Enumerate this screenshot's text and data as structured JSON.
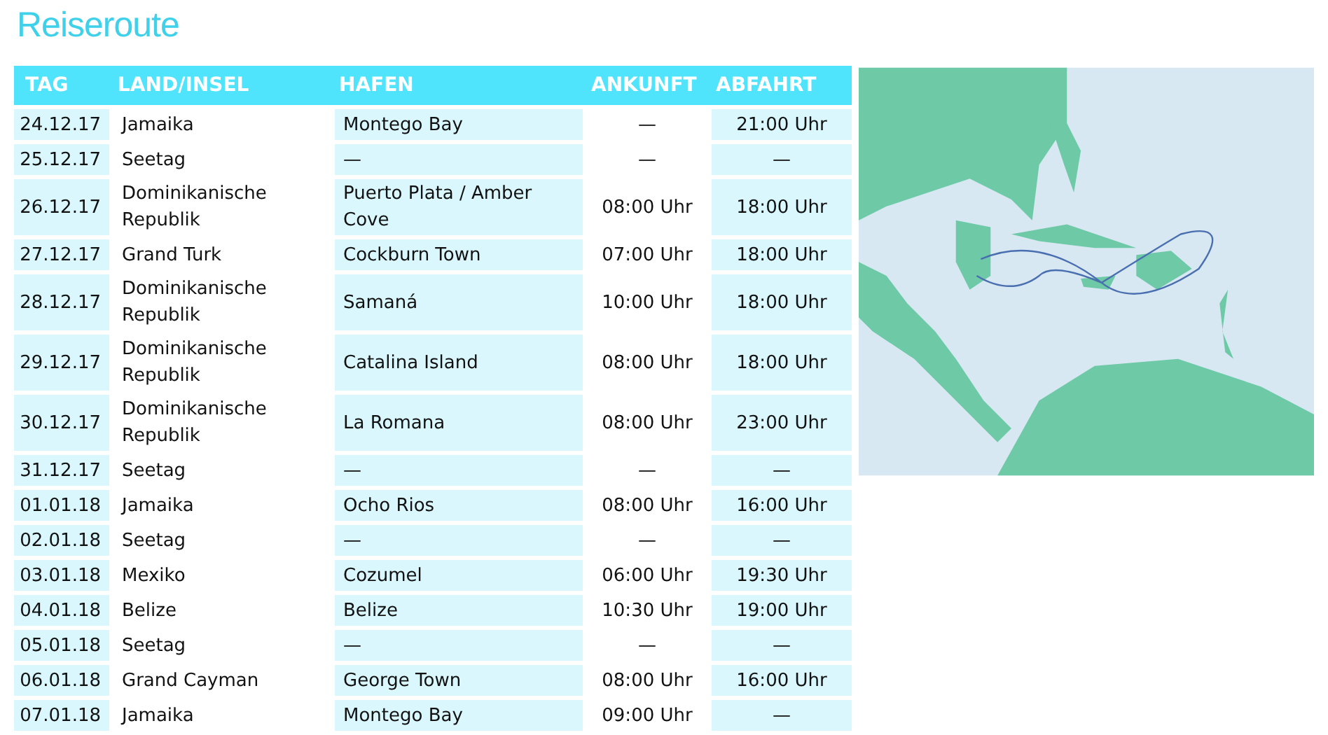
{
  "title": "Reiseroute",
  "table": {
    "columns": [
      "TAG",
      "LAND/INSEL",
      "HAFEN",
      "ANKUNFT",
      "ABFAHRT"
    ],
    "rows": [
      [
        "24.12.17",
        "Jamaika",
        "Montego Bay",
        "—",
        "21:00 Uhr"
      ],
      [
        "25.12.17",
        "Seetag",
        "—",
        "—",
        "—"
      ],
      [
        "26.12.17",
        "Dominikanische Republik",
        "Puerto Plata / Amber Cove",
        "08:00 Uhr",
        "18:00 Uhr"
      ],
      [
        "27.12.17",
        "Grand Turk",
        "Cockburn Town",
        "07:00 Uhr",
        "18:00 Uhr"
      ],
      [
        "28.12.17",
        "Dominikanische Republik",
        "Samaná",
        "10:00 Uhr",
        "18:00 Uhr"
      ],
      [
        "29.12.17",
        "Dominikanische Republik",
        "Catalina Island",
        "08:00 Uhr",
        "18:00 Uhr"
      ],
      [
        "30.12.17",
        "Dominikanische Republik",
        "La Romana",
        "08:00 Uhr",
        "23:00 Uhr"
      ],
      [
        "31.12.17",
        "Seetag",
        "—",
        "—",
        "—"
      ],
      [
        "01.01.18",
        "Jamaika",
        "Ocho Rios",
        "08:00 Uhr",
        "16:00 Uhr"
      ],
      [
        "02.01.18",
        "Seetag",
        "—",
        "—",
        "—"
      ],
      [
        "03.01.18",
        "Mexiko",
        "Cozumel",
        "06:00 Uhr",
        "19:30 Uhr"
      ],
      [
        "04.01.18",
        "Belize",
        "Belize",
        "10:30 Uhr",
        "19:00 Uhr"
      ],
      [
        "05.01.18",
        "Seetag",
        "—",
        "—",
        "—"
      ],
      [
        "06.01.18",
        "Grand Cayman",
        "George Town",
        "08:00 Uhr",
        "16:00 Uhr"
      ],
      [
        "07.01.18",
        "Jamaika",
        "Montego Bay",
        "09:00 Uhr",
        "—"
      ]
    ]
  }
}
